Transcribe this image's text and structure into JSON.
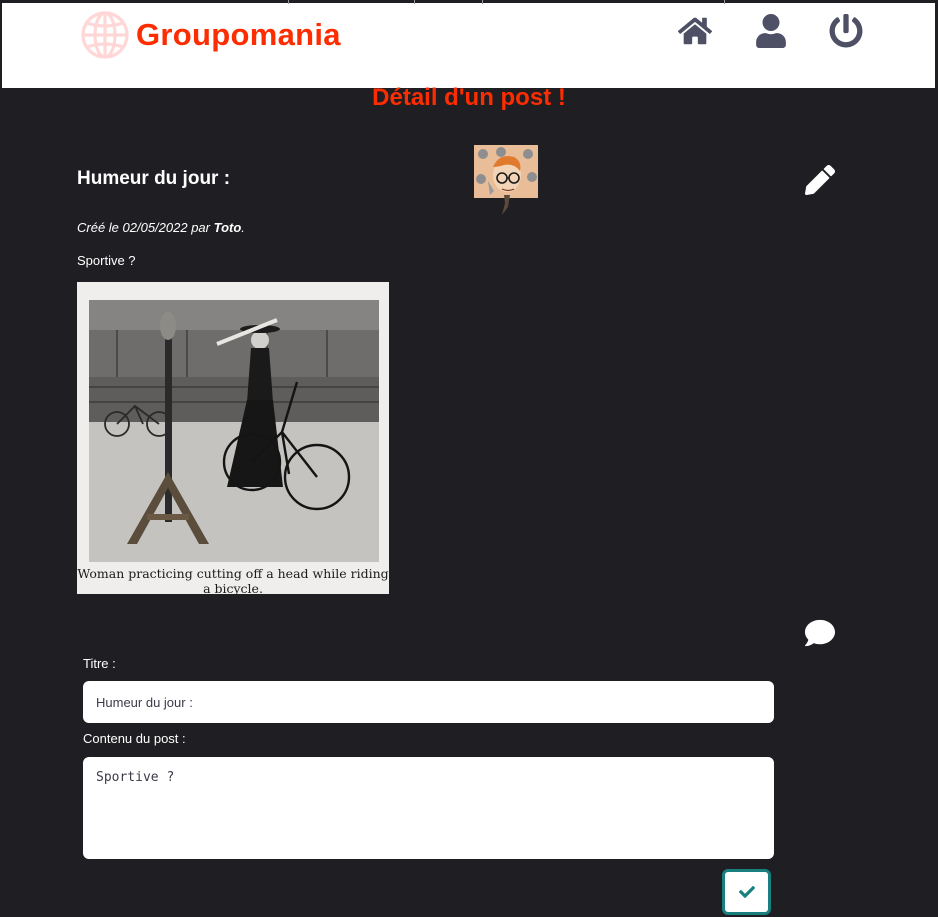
{
  "header": {
    "brand": "Groupomania",
    "brand_color": "#fd2d01",
    "icons": [
      "globe-logo-icon",
      "home-icon",
      "user-icon",
      "power-icon"
    ]
  },
  "page": {
    "title": "Détail d'un post !"
  },
  "post": {
    "title": "Humeur du jour :",
    "meta_prefix": "Créé le 02/05/2022 par",
    "author": "Toto",
    "meta_suffix": ".",
    "content": "Sportive ?",
    "image_caption": "Woman practicing cutting off a head while riding a bicycle."
  },
  "form": {
    "title_label": "Titre :",
    "title_value": "Humeur du jour :",
    "content_label": "Contenu du post :",
    "content_value": "Sportive ?"
  },
  "colors": {
    "background": "#1f1e22",
    "accent": "#fd2d01",
    "nav_icons": "#4e5166",
    "submit_border": "#1a7f7f"
  }
}
